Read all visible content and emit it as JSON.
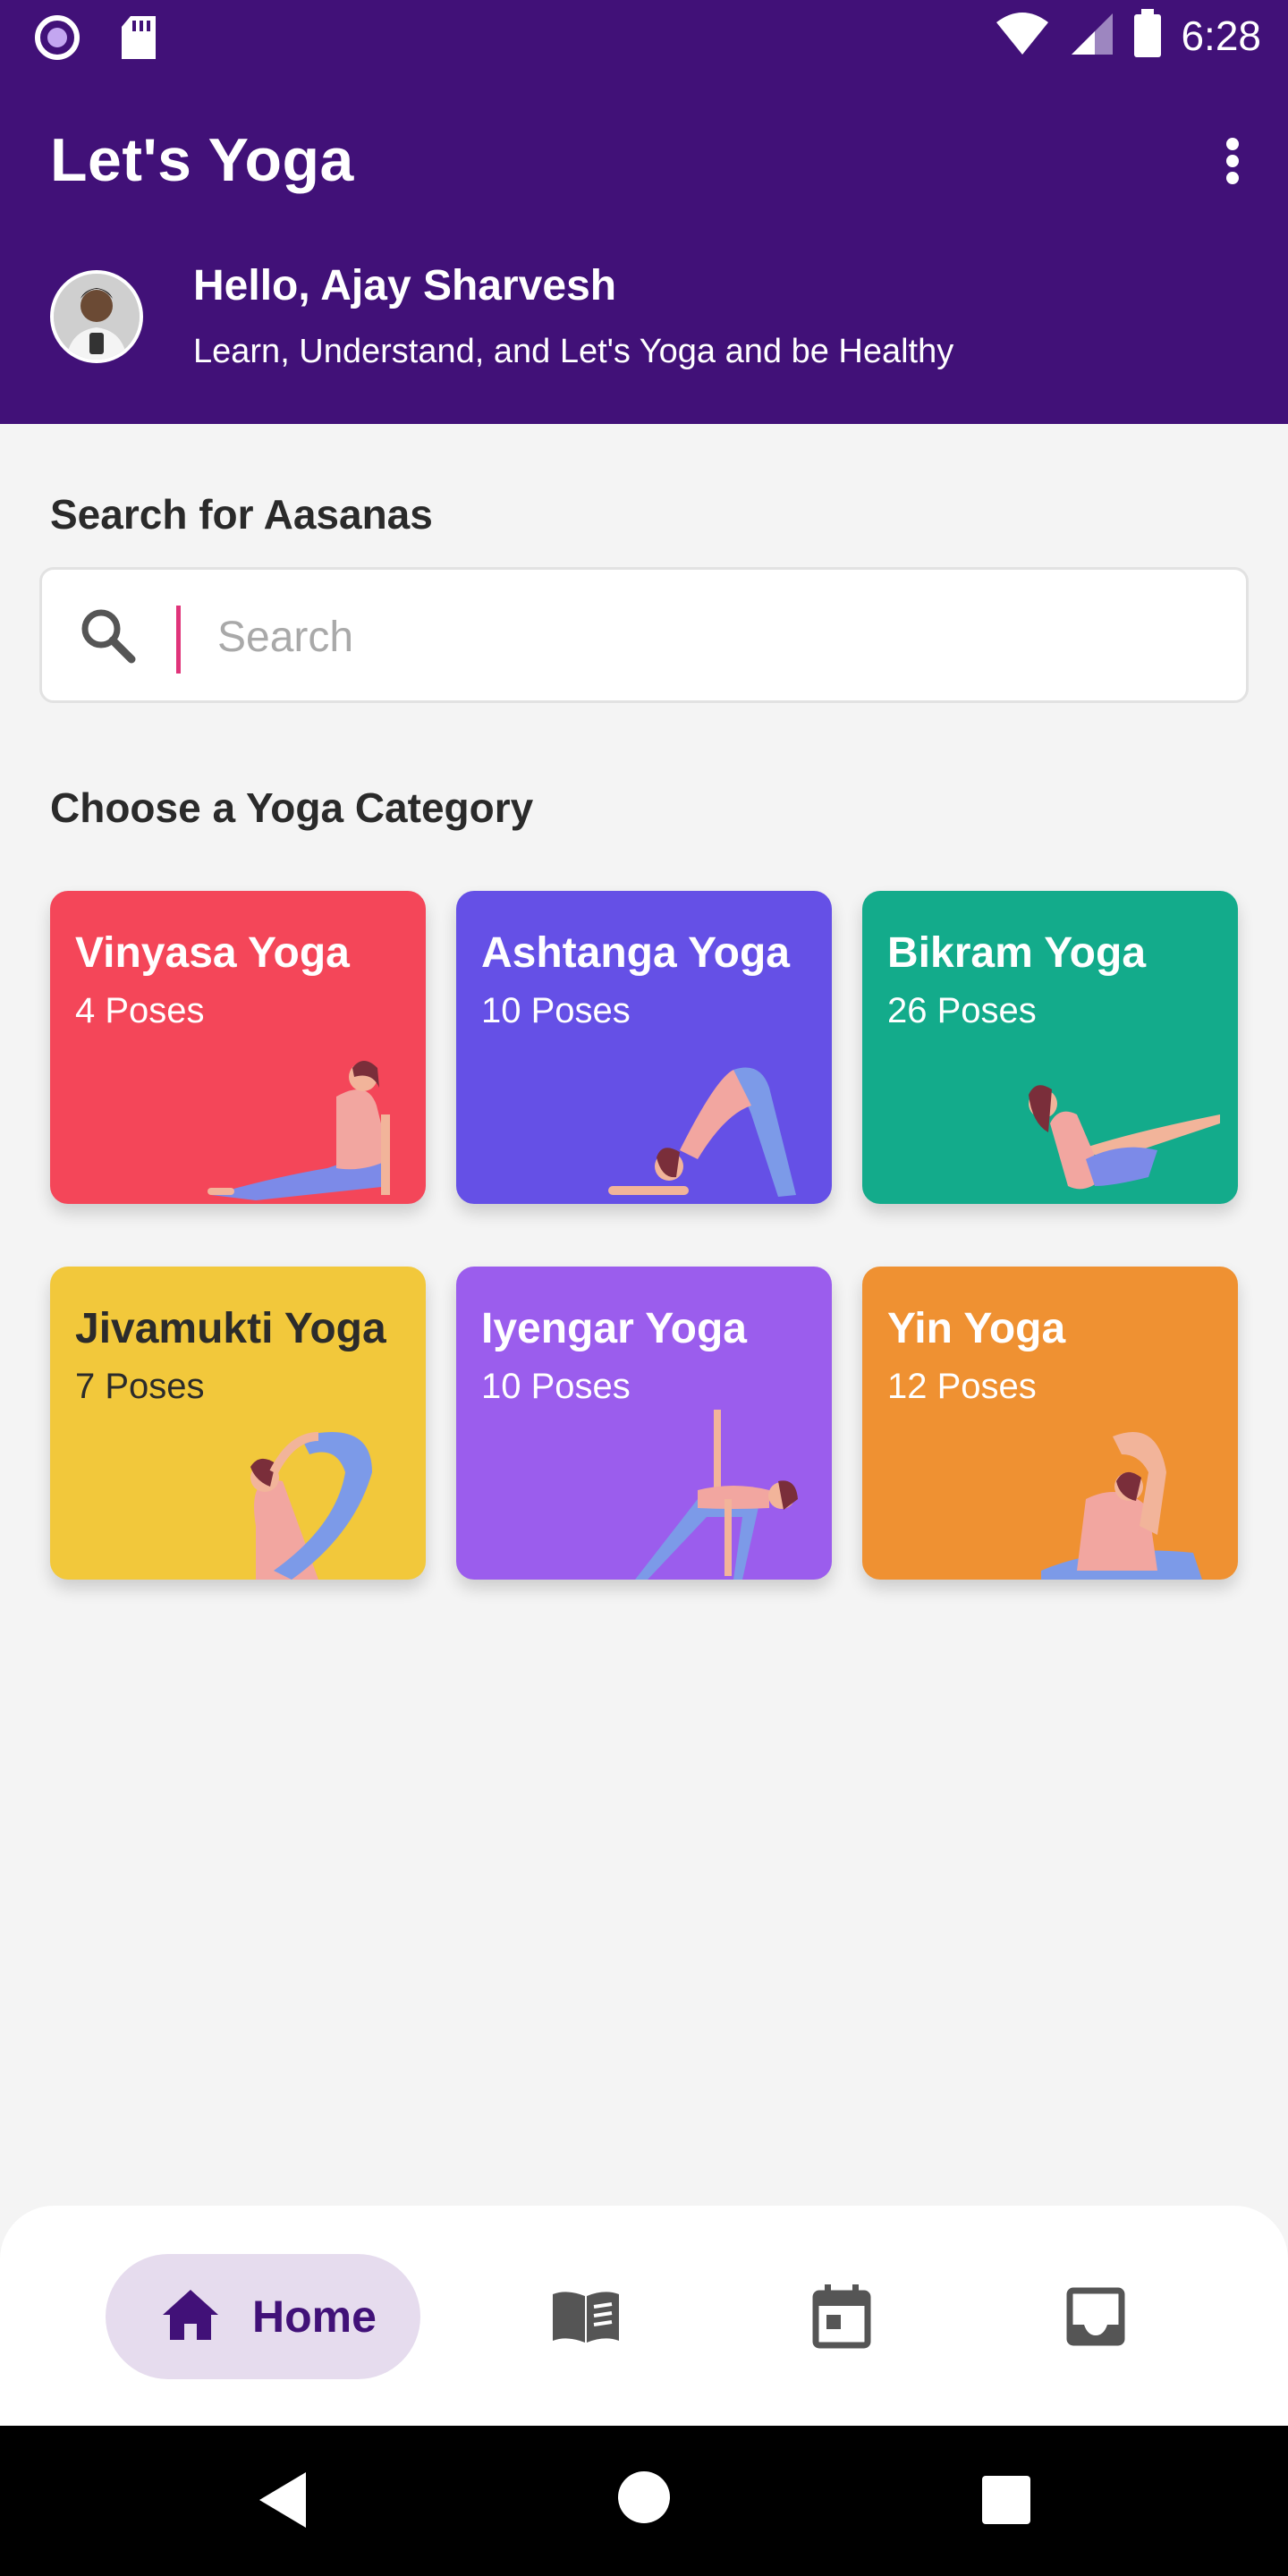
{
  "status_bar": {
    "time": "6:28",
    "icons": [
      "radio-icon",
      "sd-card-icon",
      "wifi-icon",
      "signal-icon",
      "battery-icon"
    ]
  },
  "app_bar": {
    "title": "Let's Yoga",
    "menu_icon": "more-vert-icon"
  },
  "user": {
    "greeting": "Hello, Ajay Sharvesh",
    "tagline": "Learn, Understand, and Let's Yoga and be Healthy"
  },
  "search": {
    "label": "Search for Aasanas",
    "placeholder": "Search",
    "value": ""
  },
  "categories": {
    "label": "Choose a Yoga Category",
    "items": [
      {
        "title": "Vinyasa Yoga",
        "count": "4 Poses",
        "color": "#f44659"
      },
      {
        "title": "Ashtanga Yoga",
        "count": "10 Poses",
        "color": "#6550e6"
      },
      {
        "title": "Bikram Yoga",
        "count": "26 Poses",
        "color": "#13ab8b"
      },
      {
        "title": "Jivamukti  Yoga",
        "count": "7 Poses",
        "color": "#f2c83b"
      },
      {
        "title": "Iyengar Yoga",
        "count": "10 Poses",
        "color": "#9b5ded"
      },
      {
        "title": "Yin Yoga",
        "count": "12 Poses",
        "color": "#ef9132"
      }
    ]
  },
  "bottom_nav": {
    "home_label": "Home",
    "items": [
      "home-icon",
      "book-icon",
      "calendar-icon",
      "inbox-icon"
    ]
  },
  "theme": {
    "primary": "#411178",
    "nav_active_bg": "#e6dcee"
  }
}
